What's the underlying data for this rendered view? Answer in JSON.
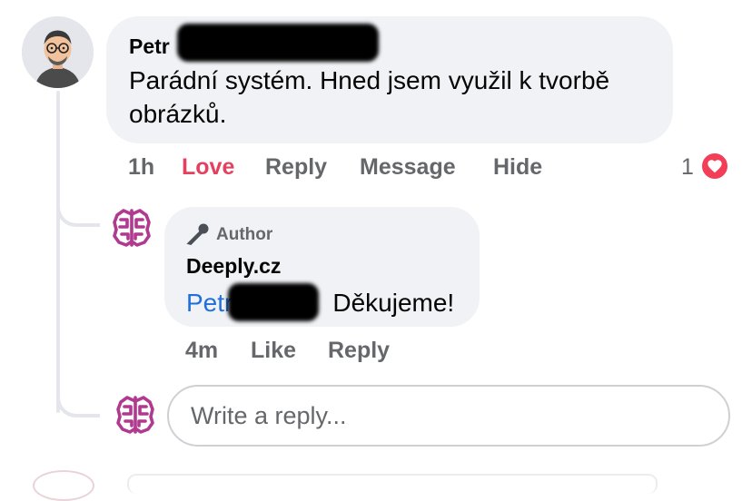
{
  "comment": {
    "author": "Petr",
    "text": "Parádní systém. Hned jsem využil k tvorbě obrázků.",
    "time": "1h",
    "actions": {
      "love": "Love",
      "reply": "Reply",
      "message": "Message",
      "hide": "Hide"
    },
    "reaction_count": "1",
    "reaction_icon": "heart-icon"
  },
  "reply": {
    "badge": "Author",
    "badge_icon": "microphone-icon",
    "author": "Deeply.cz",
    "mention": "Petr",
    "text": "Děkujeme!",
    "time": "4m",
    "actions": {
      "like": "Like",
      "reply": "Reply"
    }
  },
  "reply_box": {
    "placeholder": "Write a reply..."
  },
  "colors": {
    "love": "#e4405f",
    "heart": "#f33e58",
    "mention": "#216fdb",
    "bubble": "#f0f2f5",
    "muted": "#65676b"
  }
}
